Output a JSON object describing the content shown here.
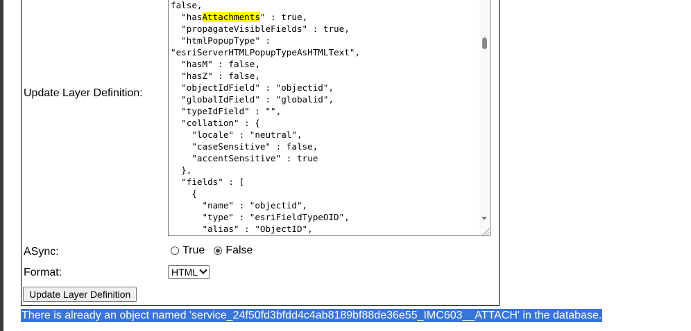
{
  "form": {
    "update_layer_label": "Update Layer Definition:",
    "async_label": "ASync:",
    "format_label": "Format:",
    "definition_lines": [
      {
        "pre": "false,",
        "hl": "",
        "post": ""
      },
      {
        "pre": "  \"has",
        "hl": "Attachments",
        "post": "\" : true,"
      },
      {
        "pre": "  \"propagateVisibleFields\" : true,",
        "hl": "",
        "post": ""
      },
      {
        "pre": "  \"htmlPopupType\" :",
        "hl": "",
        "post": ""
      },
      {
        "pre": "\"esriServerHTMLPopupTypeAsHTMLText\",",
        "hl": "",
        "post": ""
      },
      {
        "pre": "  \"hasM\" : false,",
        "hl": "",
        "post": ""
      },
      {
        "pre": "  \"hasZ\" : false,",
        "hl": "",
        "post": ""
      },
      {
        "pre": "  \"objectIdField\" : \"objectid\",",
        "hl": "",
        "post": ""
      },
      {
        "pre": "  \"globalIdField\" : \"globalid\",",
        "hl": "",
        "post": ""
      },
      {
        "pre": "  \"typeIdField\" : \"\",",
        "hl": "",
        "post": ""
      },
      {
        "pre": "  \"collation\" : {",
        "hl": "",
        "post": ""
      },
      {
        "pre": "    \"locale\" : \"neutral\",",
        "hl": "",
        "post": ""
      },
      {
        "pre": "    \"caseSensitive\" : false,",
        "hl": "",
        "post": ""
      },
      {
        "pre": "    \"accentSensitive\" : true",
        "hl": "",
        "post": ""
      },
      {
        "pre": "  },",
        "hl": "",
        "post": ""
      },
      {
        "pre": "  \"fields\" : [",
        "hl": "",
        "post": ""
      },
      {
        "pre": "    {",
        "hl": "",
        "post": ""
      },
      {
        "pre": "      \"name\" : \"objectid\",",
        "hl": "",
        "post": ""
      },
      {
        "pre": "      \"type\" : \"esriFieldTypeOID\",",
        "hl": "",
        "post": ""
      },
      {
        "pre": "      \"alias\" : \"ObjectID\",",
        "hl": "",
        "post": ""
      }
    ],
    "async_options": [
      {
        "label": "True",
        "checked": false
      },
      {
        "label": "False",
        "checked": true
      }
    ],
    "format_selected": "HTML",
    "submit_label": "Update Layer Definition"
  },
  "error_message": "There is already an object named 'service_24f50fd3bfdd4c4ab8189bf88de36e55_IMC603__ATTACH' in the database."
}
